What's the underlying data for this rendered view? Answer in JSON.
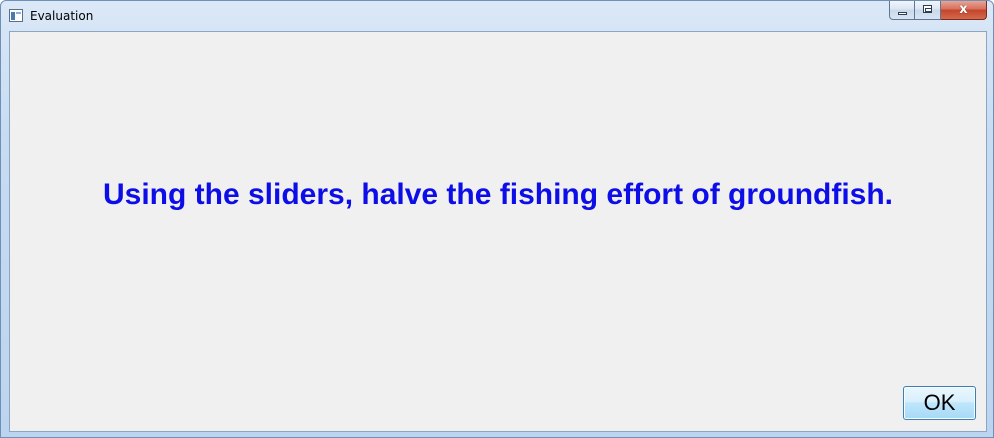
{
  "window": {
    "title": "Evaluation",
    "icon": "application-icon",
    "caption_buttons": {
      "minimize": "minimize-icon",
      "maximize": "maximize-icon",
      "close": "close-icon",
      "close_glyph": "x"
    }
  },
  "dialog": {
    "message": "Using the sliders, halve the fishing effort of groundfish.",
    "ok_label": "OK"
  },
  "colors": {
    "message_text": "#0d0de8",
    "client_background": "#f0f0f0",
    "close_button": "#c3452c"
  }
}
